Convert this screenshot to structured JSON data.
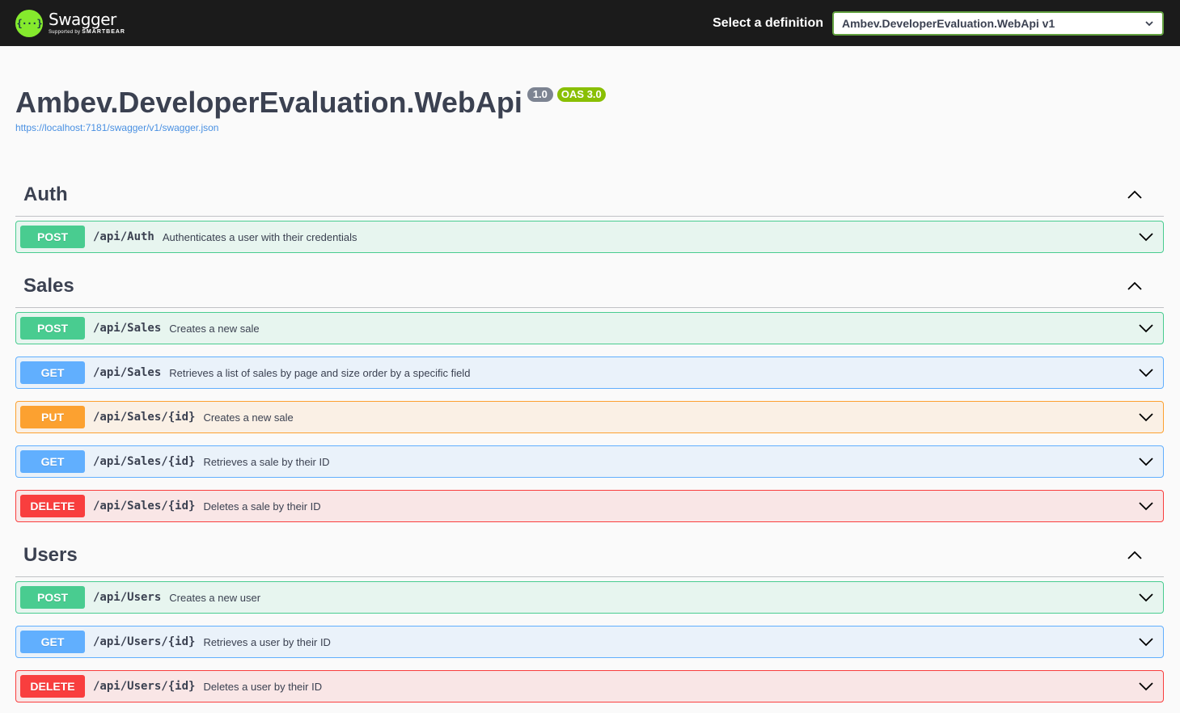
{
  "topbar": {
    "logo_glyph": "{···}",
    "logo_name": "Swagger",
    "logo_sub_prefix": "Supported by",
    "logo_sub_brand": "SMARTBEAR",
    "select_label": "Select a definition",
    "select_value": "Ambev.DeveloperEvaluation.WebApi v1",
    "accent": "#85ea2d"
  },
  "info": {
    "title": "Ambev.DeveloperEvaluation.WebApi",
    "version": "1.0",
    "oas": "OAS 3.0",
    "url": "https://localhost:7181/swagger/v1/swagger.json"
  },
  "tags": [
    {
      "name": "Auth",
      "ops": [
        {
          "method": "POST",
          "path": "/api/Auth",
          "summary": "Authenticates a user with their credentials"
        }
      ]
    },
    {
      "name": "Sales",
      "ops": [
        {
          "method": "POST",
          "path": "/api/Sales",
          "summary": "Creates a new sale"
        },
        {
          "method": "GET",
          "path": "/api/Sales",
          "summary": "Retrieves a list of sales by page and size order by a specific field"
        },
        {
          "method": "PUT",
          "path": "/api/Sales/{id}",
          "summary": "Creates a new sale"
        },
        {
          "method": "GET",
          "path": "/api/Sales/{id}",
          "summary": "Retrieves a sale by their ID"
        },
        {
          "method": "DELETE",
          "path": "/api/Sales/{id}",
          "summary": "Deletes a sale by their ID"
        }
      ]
    },
    {
      "name": "Users",
      "ops": [
        {
          "method": "POST",
          "path": "/api/Users",
          "summary": "Creates a new user"
        },
        {
          "method": "GET",
          "path": "/api/Users/{id}",
          "summary": "Retrieves a user by their ID"
        },
        {
          "method": "DELETE",
          "path": "/api/Users/{id}",
          "summary": "Deletes a user by their ID"
        }
      ]
    }
  ],
  "colors": {
    "POST": "#49cc90",
    "GET": "#61affe",
    "PUT": "#fca130",
    "DELETE": "#f93e3e"
  },
  "icons": {
    "section_toggle": "chevron-up-icon",
    "op_toggle": "chevron-down-icon"
  }
}
